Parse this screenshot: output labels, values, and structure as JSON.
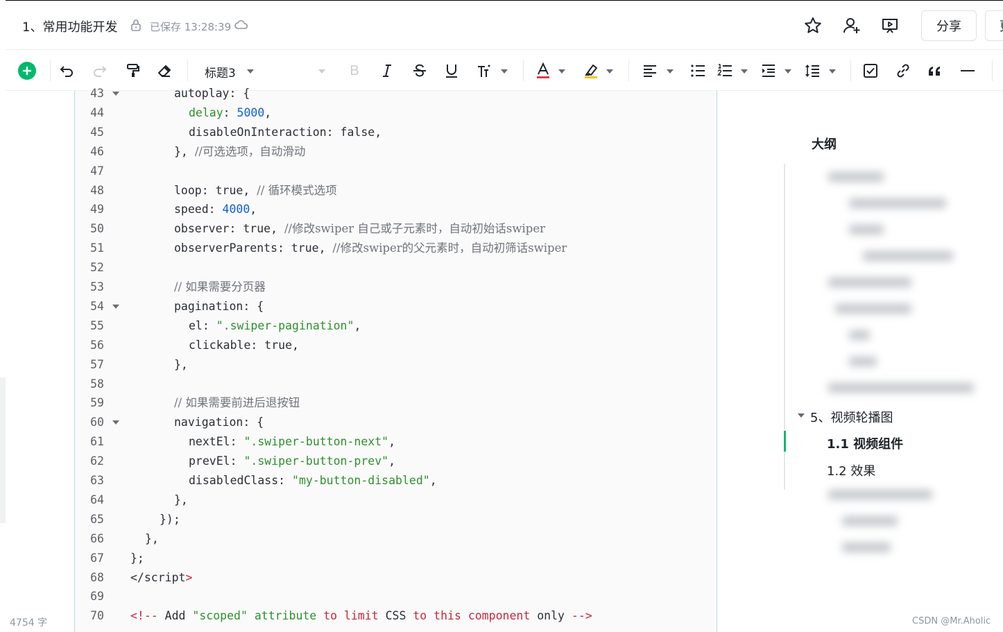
{
  "header": {
    "doc_title": "1、常用功能开发",
    "save_status": "已保存 13:28:39",
    "share_label": "分享",
    "more_label": "更"
  },
  "toolbar": {
    "heading_label": "标题3",
    "bold_label": "B"
  },
  "code": {
    "lines": [
      {
        "n": "43",
        "fold": true
      },
      {
        "n": "44",
        "fold": false
      },
      {
        "n": "45",
        "fold": false
      },
      {
        "n": "46",
        "fold": false
      },
      {
        "n": "47",
        "fold": false
      },
      {
        "n": "48",
        "fold": false
      },
      {
        "n": "49",
        "fold": false
      },
      {
        "n": "50",
        "fold": false
      },
      {
        "n": "51",
        "fold": false
      },
      {
        "n": "52",
        "fold": false
      },
      {
        "n": "53",
        "fold": false
      },
      {
        "n": "54",
        "fold": true
      },
      {
        "n": "55",
        "fold": false
      },
      {
        "n": "56",
        "fold": false
      },
      {
        "n": "57",
        "fold": false
      },
      {
        "n": "58",
        "fold": false
      },
      {
        "n": "59",
        "fold": false
      },
      {
        "n": "60",
        "fold": true
      },
      {
        "n": "61",
        "fold": false
      },
      {
        "n": "62",
        "fold": false
      },
      {
        "n": "63",
        "fold": false
      },
      {
        "n": "64",
        "fold": false
      },
      {
        "n": "65",
        "fold": false
      },
      {
        "n": "66",
        "fold": false
      },
      {
        "n": "67",
        "fold": false
      },
      {
        "n": "68",
        "fold": false
      },
      {
        "n": "69",
        "fold": false
      },
      {
        "n": "70",
        "fold": false
      }
    ],
    "t43": "autoplay: {",
    "t44a": "delay",
    "t44b": ": ",
    "t44c": "5000",
    "t44d": ",",
    "t45": "disableOnInteraction: false,",
    "t46a": "}, ",
    "t46b": "//可选选项，自动滑动",
    "t48a": "loop: true, ",
    "t48b": "// 循环模式选项",
    "t49a": "speed: ",
    "t49b": "4000",
    "t49c": ",",
    "t50a": "observer: true, ",
    "t50b": "//修改swiper 自己或子元素时，自动初始话swiper",
    "t51a": "observerParents: true, ",
    "t51b": "//修改swiper的父元素时，自动初筛话swiper",
    "t53": "// 如果需要分页器",
    "t54": "pagination: {",
    "t55a": "el: ",
    "t55b": "\".swiper-pagination\"",
    "t55c": ",",
    "t56": "clickable: true,",
    "t57": "},",
    "t59": "// 如果需要前进后退按钮",
    "t60": "navigation: {",
    "t61a": "nextEl: ",
    "t61b": "\".swiper-button-next\"",
    "t61c": ",",
    "t62a": "prevEl: ",
    "t62b": "\".swiper-button-prev\"",
    "t62c": ",",
    "t63a": "disabledClass: ",
    "t63b": "\"my-button-disabled\"",
    "t63c": ",",
    "t64": "},",
    "t65": "});",
    "t66": "},",
    "t67": "};",
    "t68a": "</script",
    "t68b": ">",
    "t70a": "<!-- ",
    "t70b": "Add ",
    "t70c": "\"scoped\"",
    "t70d": " attribute ",
    "t70e": "to",
    "t70f": " limit ",
    "t70g": "CSS",
    "t70h": " to ",
    "t70i": "this",
    "t70j": " component ",
    "t70k": "only",
    "t70l": " -->"
  },
  "word_count": "4754 字",
  "outline": {
    "title": "大纲",
    "items": [
      {
        "label": "5、视频轮播图",
        "level": 1
      },
      {
        "label": "1.1 视频组件",
        "level": 2,
        "active": true
      },
      {
        "label": "1.2 效果",
        "level": 2
      }
    ]
  },
  "watermark": "CSDN @Mr.Aholic",
  "colors": {
    "accent": "#00b96b",
    "code_border": "#b8dbe8",
    "string": "#2f8f2f",
    "number": "#1060d0",
    "keyword_red": "#c3283a"
  }
}
